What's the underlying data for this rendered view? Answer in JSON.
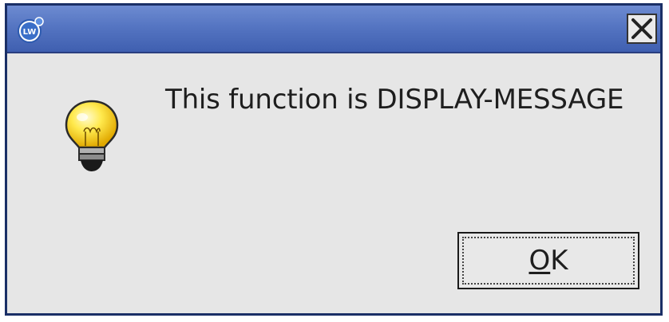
{
  "window": {
    "title_bar": {
      "app_icon": "lw-logo-icon",
      "app_icon_text": "LW",
      "close_icon": "close-icon"
    }
  },
  "dialog": {
    "icon": "lightbulb-icon",
    "message": "This function is DISPLAY-MESSAGE",
    "ok_button": {
      "mnemonic": "O",
      "rest": "K"
    }
  },
  "colors": {
    "titlebar": "#5575c2",
    "border": "#1a2f66",
    "background": "#e6e6e6"
  }
}
